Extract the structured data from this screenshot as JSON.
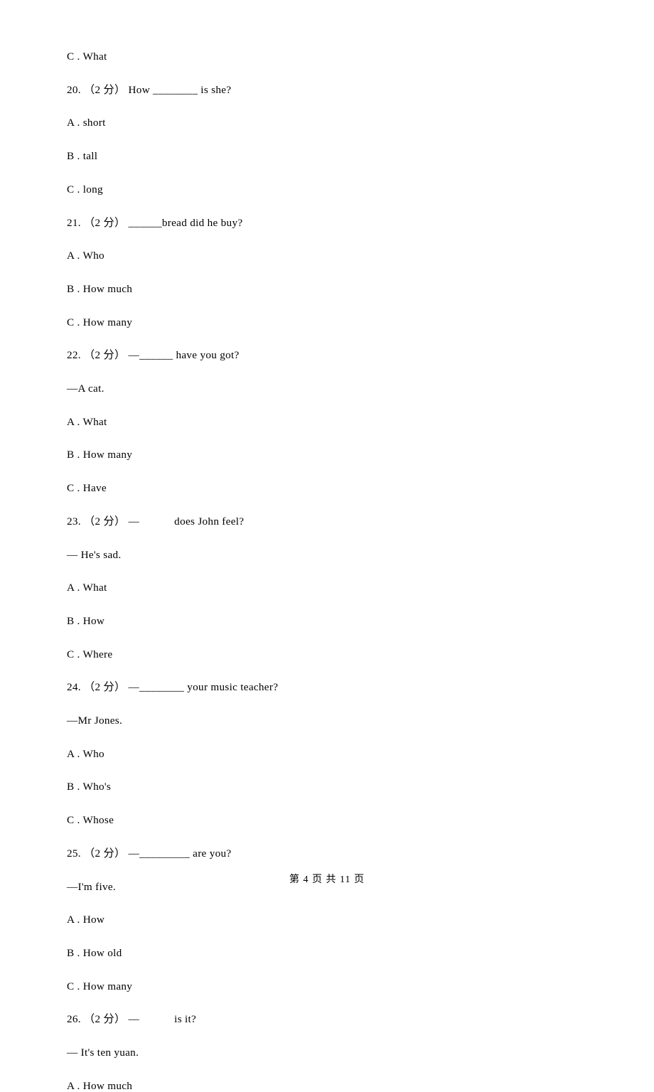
{
  "lines": {
    "l0": "C . What",
    "l1": "20. （2 分） How ________ is she?",
    "l2": "A . short",
    "l3": "B . tall",
    "l4": "C . long",
    "l5": "21. （2 分） ______bread did he buy?",
    "l6": "A . Who",
    "l7": "B . How much",
    "l8": "C . How many",
    "l9": "22. （2 分） —______ have you got?",
    "l10": "—A cat.",
    "l11": "A . What",
    "l12": "B . How many",
    "l13": "C . Have",
    "l14": "23. （2 分） —            does John feel?",
    "l15": "— He's sad.",
    "l16": "A . What",
    "l17": "B . How",
    "l18": "C . Where",
    "l19": "24. （2 分） —________ your music teacher?",
    "l20": "—Mr Jones.",
    "l21": "A . Who",
    "l22": "B . Who's",
    "l23": "C . Whose",
    "l24": "25. （2 分） —_________ are you?",
    "l25": "—I'm five.",
    "l26": "A . How",
    "l27": "B . How old",
    "l28": "C . How many",
    "l29": "26. （2 分） —            is it?",
    "l30": "— It's ten yuan.",
    "l31": "A . How much"
  },
  "footer": {
    "text": "第 4 页 共 11 页"
  }
}
